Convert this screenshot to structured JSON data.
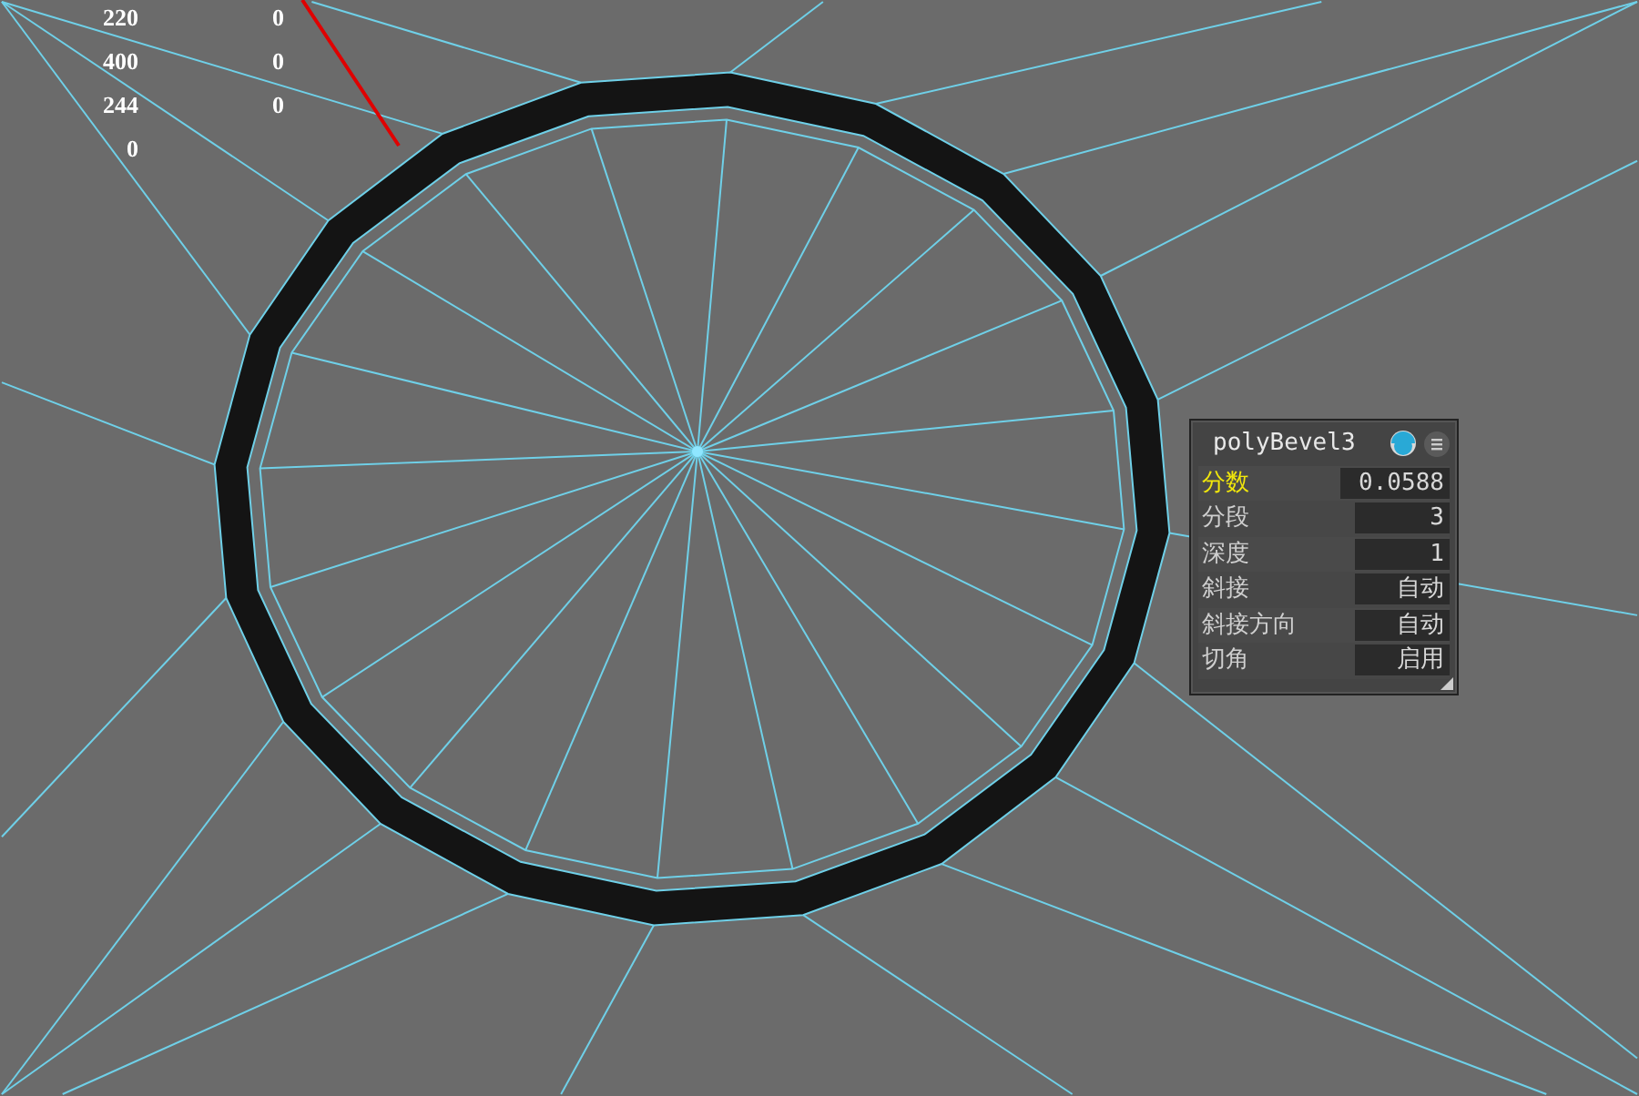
{
  "hud": [
    {
      "col_1": "220",
      "col_2": "0"
    },
    {
      "col_1": "400",
      "col_2": "0"
    },
    {
      "col_1": "244",
      "col_2": "0"
    },
    {
      "col_1": "0"
    }
  ],
  "panel": {
    "title": "polyBevel3",
    "attributes": [
      {
        "label": "分数",
        "value": "0.0588",
        "selected": true
      },
      {
        "label": "分段",
        "value": "3",
        "selected": false
      },
      {
        "label": "深度",
        "value": "1",
        "selected": false
      },
      {
        "label": "斜接",
        "value": "自动",
        "selected": false
      },
      {
        "label": "斜接方向",
        "value": "自动",
        "selected": false
      },
      {
        "label": "切角",
        "value": "启用",
        "selected": false
      }
    ]
  }
}
